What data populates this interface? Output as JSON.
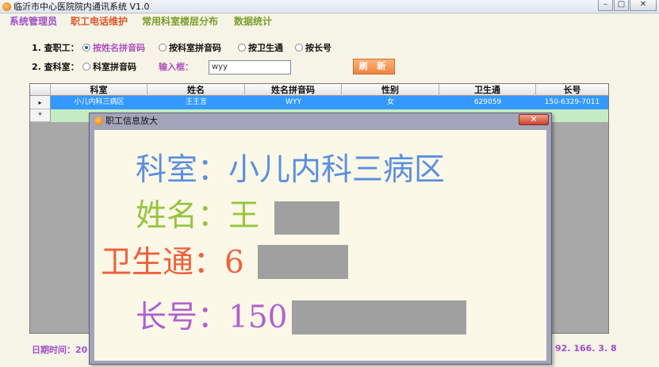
{
  "window": {
    "title": "临沂市中心医院院内通讯系统 V1.0",
    "min_label": "–",
    "max_label": "□",
    "close_label": "✕"
  },
  "menu": [
    {
      "label": "系统管理员",
      "color": "#a050c8"
    },
    {
      "label": "职工电话维护",
      "color": "#e0562a"
    },
    {
      "label": "常用科室楼层分布",
      "color": "#7a9d2a"
    },
    {
      "label": "数据统计",
      "color": "#7a9d2a"
    }
  ],
  "search": {
    "row1_label": "1. 查职工：",
    "row1_options": [
      "按姓名拼音码",
      "按科室拼音码",
      "按卫生通",
      "按长号"
    ],
    "row1_selected": "按姓名拼音码",
    "row2_label": "2. 查科室：",
    "row2_option": "科室拼音码",
    "input_label": "输入框：",
    "input_value": "wyy",
    "refresh_label": "刷 新"
  },
  "table": {
    "headers": [
      "科室",
      "姓名",
      "姓名拼音码",
      "性别",
      "卫生通",
      "长号"
    ],
    "rows": [
      [
        "小儿内科三病区",
        "王王言",
        "WYY",
        "女",
        "629059",
        "150-6329-7011"
      ]
    ],
    "row_indicator": "▸",
    "new_row_indicator": "*"
  },
  "status": {
    "left": "日期时间：20",
    "right": "92. 166. 3. 8"
  },
  "popup": {
    "title": "职工信息放大",
    "close_label": "✕",
    "dept_line": "科室：小儿内科三病区",
    "name_line": "姓名：王",
    "phone_line": "卫生通：6",
    "mobile_line": "长号：150",
    "colors": {
      "dept": "#5b8fe0",
      "name": "#98c440",
      "phone": "#f0603c",
      "mobile": "#b060d0"
    }
  }
}
